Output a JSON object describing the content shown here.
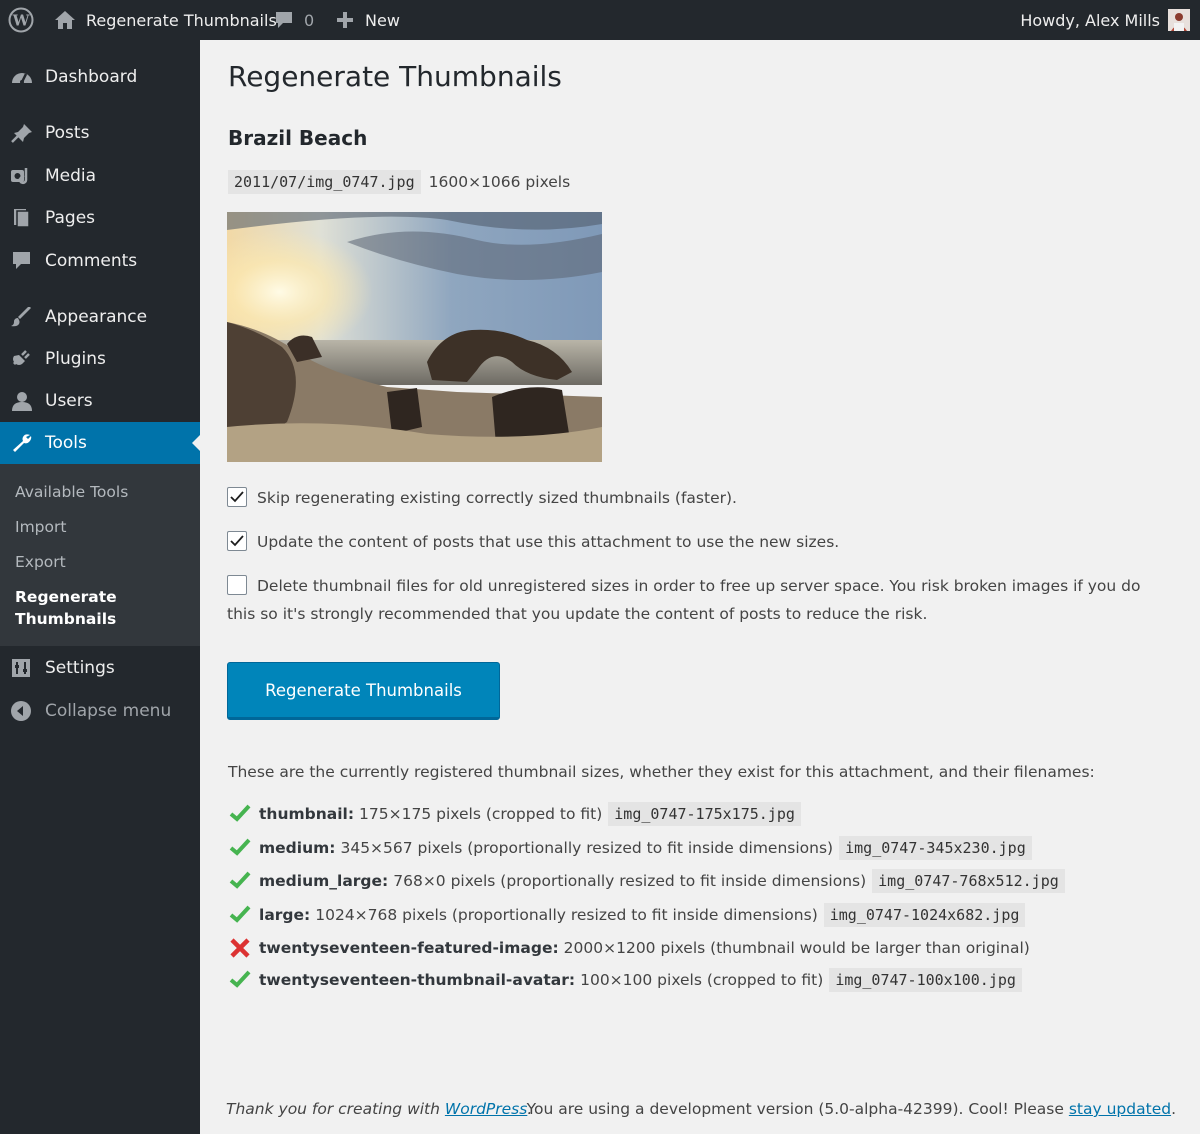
{
  "admin_bar": {
    "site_name": "Regenerate Thumbnails",
    "comments_count": "0",
    "new_label": "New",
    "howdy": "Howdy, Alex Mills"
  },
  "sidebar": {
    "items": [
      {
        "label": "Dashboard",
        "icon": "dashboard-icon"
      },
      {
        "label": "Posts",
        "icon": "pin-icon"
      },
      {
        "label": "Media",
        "icon": "media-icon"
      },
      {
        "label": "Pages",
        "icon": "pages-icon"
      },
      {
        "label": "Comments",
        "icon": "comment-icon"
      },
      {
        "label": "Appearance",
        "icon": "brush-icon"
      },
      {
        "label": "Plugins",
        "icon": "plug-icon"
      },
      {
        "label": "Users",
        "icon": "user-icon"
      },
      {
        "label": "Tools",
        "icon": "wrench-icon"
      },
      {
        "label": "Settings",
        "icon": "settings-icon"
      },
      {
        "label": "Collapse menu",
        "icon": "collapse-icon"
      }
    ],
    "submenu": [
      "Available Tools",
      "Import",
      "Export",
      "Regenerate Thumbnails"
    ]
  },
  "page": {
    "title": "Regenerate Thumbnails",
    "attachment_title": "Brazil Beach",
    "file_path": "2011/07/img_0747.jpg",
    "dimensions": "1600×1066 pixels"
  },
  "options": [
    {
      "label": "Skip regenerating existing correctly sized thumbnails (faster).",
      "checked": true
    },
    {
      "label": "Update the content of posts that use this attachment to use the new sizes.",
      "checked": true
    },
    {
      "label": "Delete thumbnail files for old unregistered sizes in order to free up server space. You risk broken images if you do this so it's strongly recommended that you update the content of posts to reduce the risk.",
      "checked": false
    }
  ],
  "button_label": "Regenerate Thumbnails",
  "sizes_intro": "These are the currently registered thumbnail sizes, whether they exist for this attachment, and their filenames:",
  "sizes": [
    {
      "name": "thumbnail:",
      "desc": "175×175 pixels (cropped to fit)",
      "file": "img_0747-175x175.jpg",
      "ok": true
    },
    {
      "name": "medium:",
      "desc": "345×567 pixels (proportionally resized to fit inside dimensions)",
      "file": "img_0747-345x230.jpg",
      "ok": true
    },
    {
      "name": "medium_large:",
      "desc": "768×0 pixels (proportionally resized to fit inside dimensions)",
      "file": "img_0747-768x512.jpg",
      "ok": true
    },
    {
      "name": "large:",
      "desc": "1024×768 pixels (proportionally resized to fit inside dimensions)",
      "file": "img_0747-1024x682.jpg",
      "ok": true
    },
    {
      "name": "twentyseventeen-featured-image:",
      "desc": "2000×1200 pixels (thumbnail would be larger than original)",
      "file": "",
      "ok": false
    },
    {
      "name": "twentyseventeen-thumbnail-avatar:",
      "desc": "100×100 pixels (cropped to fit)",
      "file": "img_0747-100x100.jpg",
      "ok": true
    }
  ],
  "footer": {
    "thanks_prefix": "Thank you for creating with ",
    "thanks_link": "WordPress",
    "thanks_suffix": ".",
    "version_text": "You are using a development version (5.0-alpha-42399). Cool! Please ",
    "version_link": "stay updated",
    "version_suffix": "."
  },
  "colors": {
    "accent": "#0073aa",
    "button": "#0085ba",
    "sidebar": "#23282d",
    "submenu": "#32373c",
    "ok": "#46b450",
    "error": "#dc3232"
  }
}
